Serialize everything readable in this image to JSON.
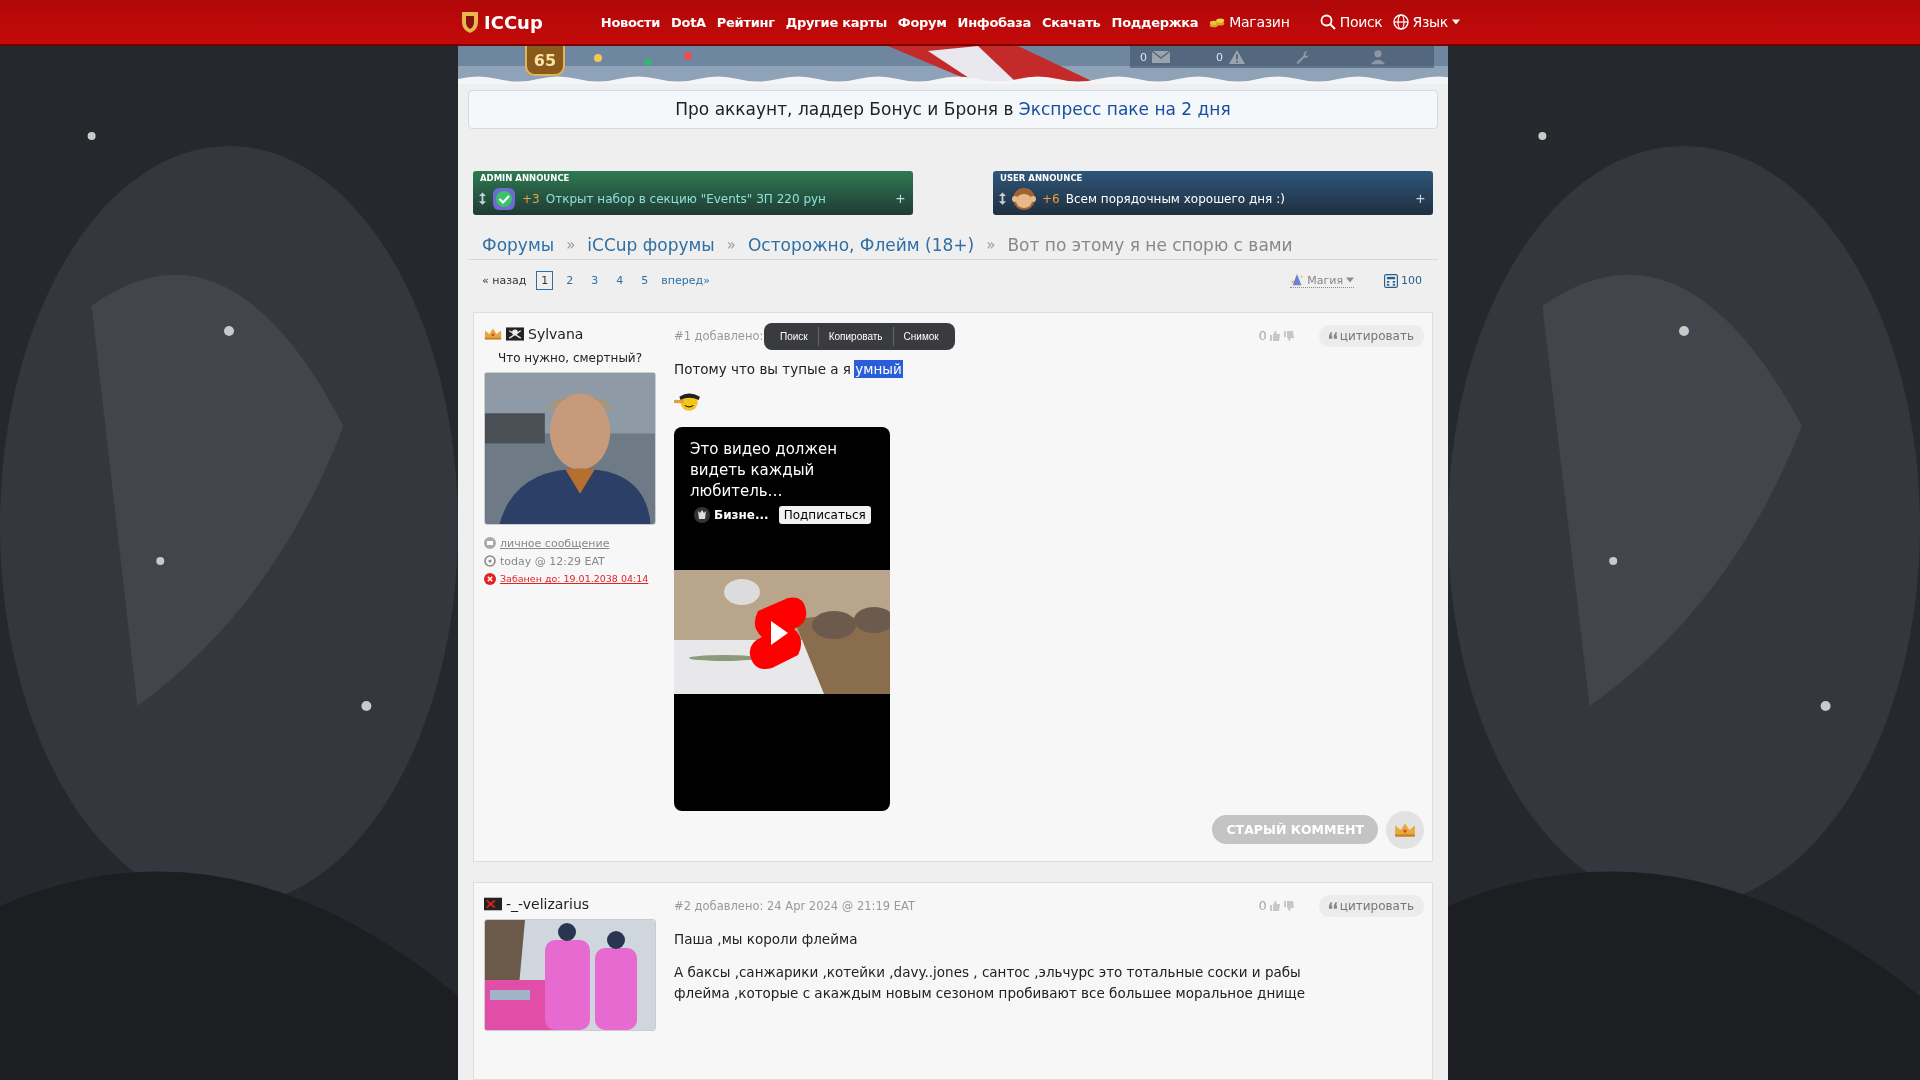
{
  "nav": {
    "logo": "ICCup",
    "items": [
      {
        "label": "Новости",
        "kind": "link"
      },
      {
        "label": "DotA",
        "kind": "link"
      },
      {
        "label": "Рейтинг",
        "kind": "link"
      },
      {
        "label": "Другие карты",
        "kind": "link"
      },
      {
        "label": "Форум",
        "kind": "link"
      },
      {
        "label": "Инфобаза",
        "kind": "link"
      },
      {
        "label": "Скачать",
        "kind": "link"
      },
      {
        "label": "Поддержка",
        "kind": "link"
      },
      {
        "label": "Магазин",
        "kind": "shop"
      }
    ],
    "search": "Поиск",
    "language": "Язык"
  },
  "header": {
    "level": "65",
    "counters": [
      {
        "kind": "mail",
        "count": "0"
      },
      {
        "kind": "alert",
        "count": "0"
      },
      {
        "kind": "tools"
      },
      {
        "kind": "profile"
      }
    ]
  },
  "promo": {
    "text": "Про аккаунт, ладдер Бонус и Броня в ",
    "link": "Экспресс паке на 2 дня"
  },
  "announces": [
    {
      "kind": "admin",
      "title": "ADMIN ANNOUNCE",
      "score": "+3",
      "text": "Открыт набор в секцию \"Events\" ЗП 220 рун",
      "button": "+"
    },
    {
      "kind": "user",
      "title": "USER ANNOUNCE",
      "score": "+6",
      "text": "Всем порядочным хорошего дня :)",
      "button": "+"
    }
  ],
  "breadcrumbs": [
    {
      "label": "Форумы",
      "link": true,
      "separator": "»"
    },
    {
      "label": "iCCup форумы",
      "link": true,
      "separator": "»"
    },
    {
      "label": "Осторожно, Флейм (18+)",
      "link": true,
      "separator": "»"
    },
    {
      "label": "Вот по этому я не спорю с вами",
      "link": false
    }
  ],
  "pagination": {
    "prev": "« назад",
    "pages": [
      {
        "label": "1",
        "selected": true
      },
      {
        "label": "2",
        "selected": false
      },
      {
        "label": "3",
        "selected": false
      },
      {
        "label": "4",
        "selected": false
      },
      {
        "label": "5",
        "selected": false
      }
    ],
    "next": "вперед»"
  },
  "toolbar": {
    "theme": "Магия",
    "count": "100"
  },
  "posts": [
    {
      "author": "Sylvana",
      "badges": [
        {
          "kind": "crown"
        },
        {
          "kind": "pirate"
        }
      ],
      "status": "Что нужно, смертный?",
      "avatar": {
        "kind": "picture"
      },
      "info": [
        {
          "kind": "message",
          "text": "личное сообщение"
        },
        {
          "kind": "time",
          "text": "today @ 12:29 EAT"
        },
        {
          "kind": "ban",
          "text": "Забанен до: 19.01.2038 04:14"
        }
      ],
      "meta": "#1 добавлено:",
      "rating": "0",
      "quote": "цитировать",
      "context_menu": [
        "Поиск",
        "Копировать",
        "Снимок"
      ],
      "body": [
        {
          "kind": "text",
          "parts": [
            {
              "text": "Потому что вы тупые а я ",
              "selected": false
            },
            {
              "text": "умный",
              "selected": true
            }
          ]
        },
        {
          "kind": "smiley"
        },
        {
          "kind": "video",
          "title": "Это видео должен видеть каждый любитель…",
          "channel": "Бизне...",
          "subscribe": "Подписаться"
        }
      ],
      "footer": {
        "button": "СТАРЫЙ КОММЕНТ",
        "disabled": true,
        "crown": true
      }
    },
    {
      "author": "-_-velizarius",
      "badges": [
        {
          "kind": "flag"
        }
      ],
      "avatar": {
        "kind": "picture"
      },
      "meta": "#2 добавлено: 24 Apr 2024 @ 21:19 EAT",
      "rating": "0",
      "quote": "цитировать",
      "body": [
        {
          "kind": "text",
          "parts": [
            {
              "text": "Паша ,мы короли флейма",
              "selected": false
            }
          ]
        },
        {
          "kind": "text",
          "parts": [
            {
              "text": "А баксы ,санжарики ,котейки ,davy..jones , сантос ,эльчурс это тотальные соски и рабы флейма ,которые с акаждым новым сезоном пробивают все большее моральное днище",
              "selected": false
            }
          ]
        }
      ]
    }
  ]
}
